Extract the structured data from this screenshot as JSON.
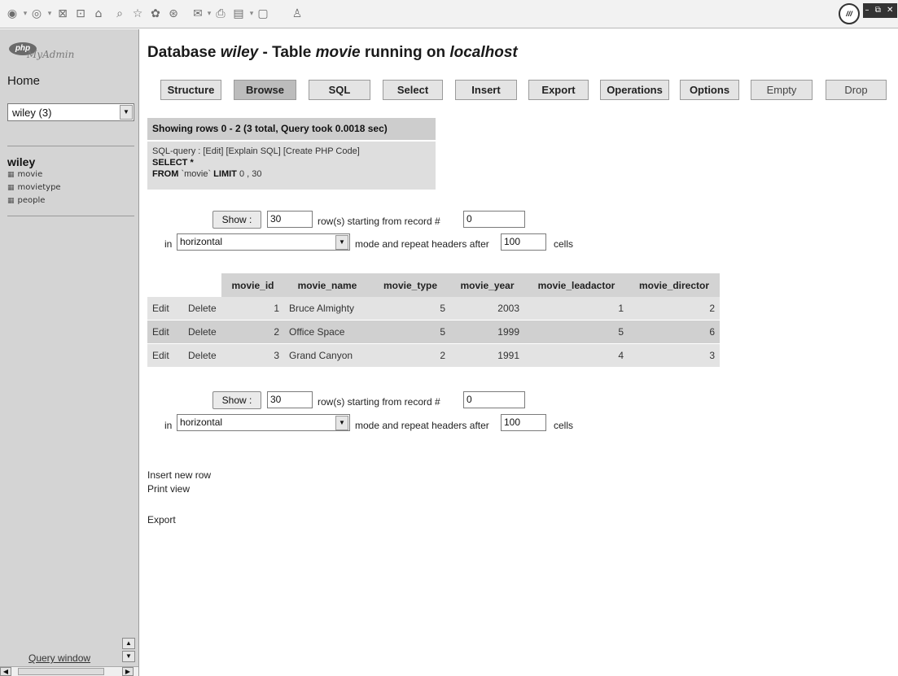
{
  "toolbar": {
    "icons": [
      "back-icon",
      "dropdown-icon",
      "forward-icon",
      "dropdown-icon",
      "stop-icon",
      "refresh-icon",
      "home-icon",
      "search-icon",
      "favorites-icon",
      "media-icon",
      "history-icon",
      "mail-icon",
      "print-icon",
      "edit-icon",
      "discuss-icon",
      "messenger-icon"
    ],
    "logo_text": "///",
    "window_controls": "– ⧉ ✕"
  },
  "left": {
    "logo_php": "php",
    "logo_myadmin": "MyAdmin",
    "home": "Home",
    "db_select_value": "wiley (3)",
    "db_name": "wiley",
    "tables": [
      "movie",
      "movietype",
      "people"
    ],
    "query_window": "Query window"
  },
  "main": {
    "title_prefix": "Database ",
    "db": "wiley",
    "title_mid": " - Table ",
    "table": "movie",
    "title_suffix": " running on ",
    "host": "localhost",
    "tabs": [
      "Structure",
      "Browse",
      "SQL",
      "Select",
      "Insert",
      "Export",
      "Operations",
      "Options",
      "Empty",
      "Drop"
    ],
    "notice": "Showing rows 0 - 2 (3 total, Query took 0.0018 sec)",
    "sql": {
      "prefix": "SQL-query : ",
      "edit": "[Edit]",
      "explain": "[Explain SQL]",
      "php": "[Create PHP Code]",
      "line1": "SELECT *",
      "line2_kw": "FROM",
      "line2_tbl": " `movie` ",
      "line2_kw2": "LIMIT",
      "line2_rest": " 0 , 30"
    },
    "nav": {
      "show": "Show :",
      "rows": "30",
      "starting": "row(s) starting from record #",
      "record": "0",
      "in": "in",
      "mode": "horizontal",
      "repeat": "mode and repeat headers after",
      "headers": "100",
      "cells": "cells"
    },
    "columns": [
      "movie_id",
      "movie_name",
      "movie_type",
      "movie_year",
      "movie_leadactor",
      "movie_director"
    ],
    "row_actions": [
      "Edit",
      "Delete"
    ],
    "rows": [
      [
        "1",
        "Bruce Almighty",
        "5",
        "2003",
        "1",
        "2"
      ],
      [
        "2",
        "Office Space",
        "5",
        "1999",
        "5",
        "6"
      ],
      [
        "3",
        "Grand Canyon",
        "2",
        "1991",
        "4",
        "3"
      ]
    ],
    "links": [
      "Insert new row",
      "Print view",
      "Export"
    ]
  }
}
